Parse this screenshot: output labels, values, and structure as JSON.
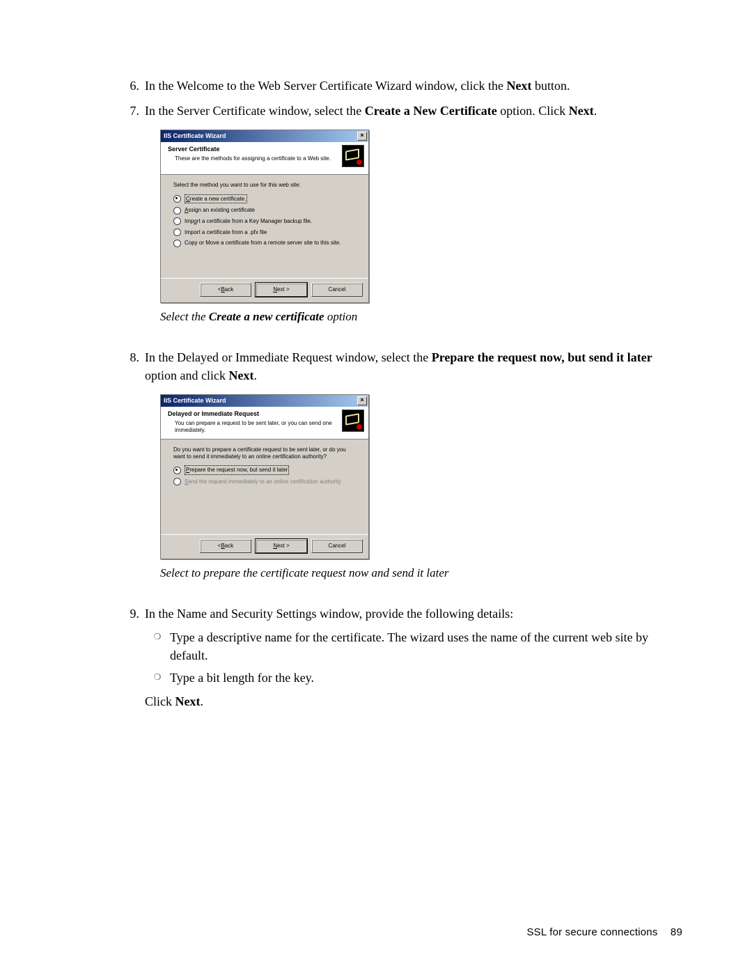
{
  "steps": {
    "s6": {
      "num": "6.",
      "t1": "In the Welcome to the Web Server Certificate Wizard window, click the ",
      "b1": "Next",
      "t2": " button."
    },
    "s7": {
      "num": "7.",
      "t1": "In the Server Certificate window, select the ",
      "b1": "Create a New Certificate",
      "t2": " option. Click ",
      "b2": "Next",
      "t3": "."
    },
    "s8": {
      "num": "8.",
      "t1": "In the Delayed or Immediate Request window, select the ",
      "b1": "Prepare the request now, but send it later",
      "t2": " option and click ",
      "b2": "Next",
      "t3": "."
    },
    "s9": {
      "num": "9.",
      "t1": "In the Name and Security Settings window, provide the following details:",
      "sub1": "Type a descriptive name for the certificate. The wizard uses the name of the current web site by default.",
      "sub2": "Type a bit length for the key.",
      "c1": "Click ",
      "cb": "Next",
      "c2": "."
    }
  },
  "caption1_a": "Select the ",
  "caption1_b": "Create a new certificate",
  "caption1_c": " option",
  "caption2": "Select to prepare the certificate request now and send it later",
  "dialog1": {
    "title": "IIS Certificate Wizard",
    "htitle": "Server Certificate",
    "hdesc": "These are the methods for assigning a certificate to a Web site.",
    "instr": "Select the method you want to use for this web site:",
    "opts": {
      "o1_u": "C",
      "o1_r": "reate a new certificate.",
      "o2_u": "A",
      "o2_r": "ssign an existing certificate",
      "o3_a": "Imp",
      "o3_u": "o",
      "o3_b": "rt a certificate from a Key Manager backup file.",
      "o4_a": "Import a certificate from a .pfx file",
      "o5_a": "Copy or Move a certificate from a remote server site to this site."
    }
  },
  "dialog2": {
    "title": "IIS Certificate Wizard",
    "htitle": "Delayed or Immediate Request",
    "hdesc": "You can prepare a request to be sent later, or you can send one immediately.",
    "instr": "Do you want to prepare a certificate request to be sent later, or do you want to send it immediately to an online certification authority?",
    "opts": {
      "o1_u": "P",
      "o1_r": "repare the request now, but send it later",
      "o2_u": "S",
      "o2_r": "end the request immediately to an online certification authority"
    }
  },
  "buttons": {
    "back_lt": "< ",
    "back_u": "B",
    "back_r": "ack",
    "next_u": "N",
    "next_r": "ext >",
    "cancel": "Cancel"
  },
  "footer": {
    "label": "SSL for secure connections",
    "page": "89"
  }
}
